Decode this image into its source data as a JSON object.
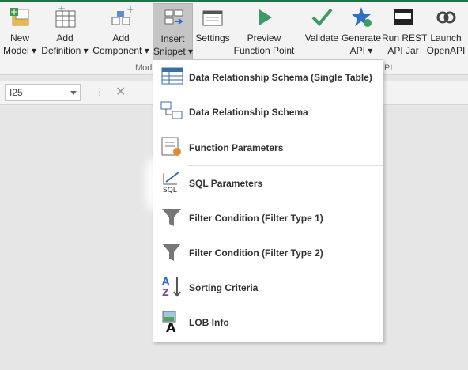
{
  "ribbon": {
    "buttons": [
      {
        "line1": "New",
        "line2": "Model ▾",
        "icon": "new-model-icon"
      },
      {
        "line1": "Add",
        "line2": "Definition ▾",
        "icon": "add-definition-icon"
      },
      {
        "line1": "Add",
        "line2": "Component ▾",
        "icon": "add-component-icon"
      },
      {
        "line1": "Insert",
        "line2": "Snippet ▾",
        "icon": "insert-snippet-icon"
      },
      {
        "line1": "Settings",
        "line2": "",
        "icon": "settings-icon"
      },
      {
        "line1": "Preview",
        "line2": "Function Point",
        "icon": "preview-icon"
      },
      {
        "line1": "Validate",
        "line2": "",
        "icon": "validate-icon"
      },
      {
        "line1": "Generate",
        "line2": "API ▾",
        "icon": "generate-api-icon"
      },
      {
        "line1": "Run REST",
        "line2": "API Jar",
        "icon": "run-rest-icon"
      },
      {
        "line1": "Launch",
        "line2": "OpenAPI",
        "icon": "launch-openapi-icon"
      }
    ],
    "group_label_left": "Mod",
    "group_label_right": "PI"
  },
  "formula_bar": {
    "name_box": "I25",
    "dots": "⋮",
    "cancel": "✕"
  },
  "snippet_menu": {
    "items": [
      {
        "label": "Data Relationship Schema (Single Table)",
        "icon": "table-icon"
      },
      {
        "label": "Data Relationship Schema",
        "icon": "relationship-icon"
      },
      {
        "label": "Function Parameters",
        "icon": "function-parameters-icon"
      },
      {
        "label": "SQL Parameters",
        "icon": "sql-icon"
      },
      {
        "label": "Filter Condition (Filter Type 1)",
        "icon": "filter-icon"
      },
      {
        "label": "Filter Condition (Filter Type 2)",
        "icon": "filter-icon"
      },
      {
        "label": "Sorting Criteria",
        "icon": "sort-az-icon"
      },
      {
        "label": "LOB Info",
        "icon": "lob-info-icon"
      }
    ]
  },
  "colors": {
    "accent": "#217346",
    "green_arrow": "#3d9a63",
    "blue_star": "#2f6fc4"
  }
}
